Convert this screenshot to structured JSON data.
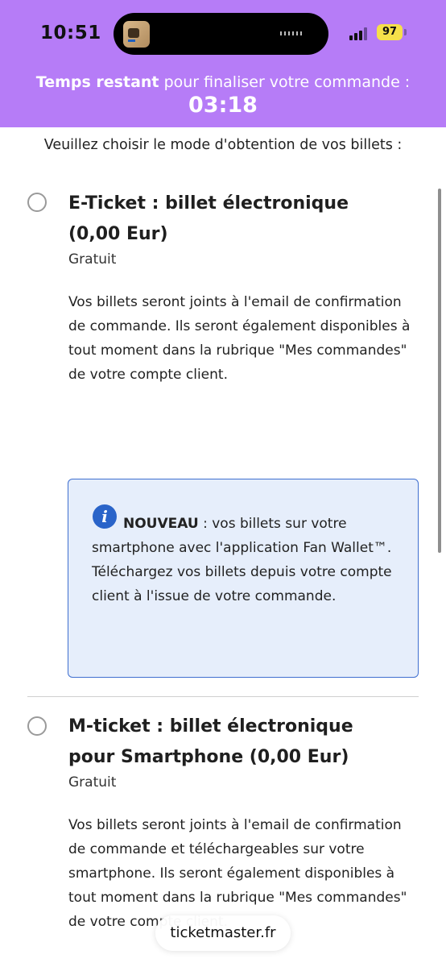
{
  "status_bar": {
    "time": "10:51",
    "battery": "97"
  },
  "timer": {
    "label_bold": "Temps restant",
    "label_rest": "pour finaliser votre commande :",
    "value": "03:18"
  },
  "intro": "Veuillez choisir le mode d'obtention de vos billets :",
  "options": [
    {
      "title": "E-Ticket : billet électronique (0,00 Eur)",
      "price": "Gratuit",
      "description": "Vos billets seront joints à l'email de confirmation de commande. Ils seront également disponibles à tout moment dans la rubrique \"Mes commandes\" de votre compte client.",
      "selected": false
    },
    {
      "title": "M-ticket : billet électronique pour Smartphone (0,00 Eur)",
      "price": "Gratuit",
      "description": "Vos billets seront joints à l'email de confirmation de commande et téléchargeables sur votre smartphone. Ils seront également disponibles à tout moment dans la rubrique \"Mes commandes\" de votre compte client.",
      "selected": false
    }
  ],
  "info": {
    "icon": "info-icon",
    "lead": "NOUVEAU",
    "text": " : vos billets sur votre smartphone avec l'application Fan Wallet™.",
    "text2": "Téléchargez vos billets depuis votre compte client à l'issue de votre commande."
  },
  "browser": {
    "url": "ticketmaster.fr"
  },
  "colors": {
    "header": "#b67cf7",
    "info_bg": "#e6eefb",
    "info_border": "#3f6fd0"
  }
}
